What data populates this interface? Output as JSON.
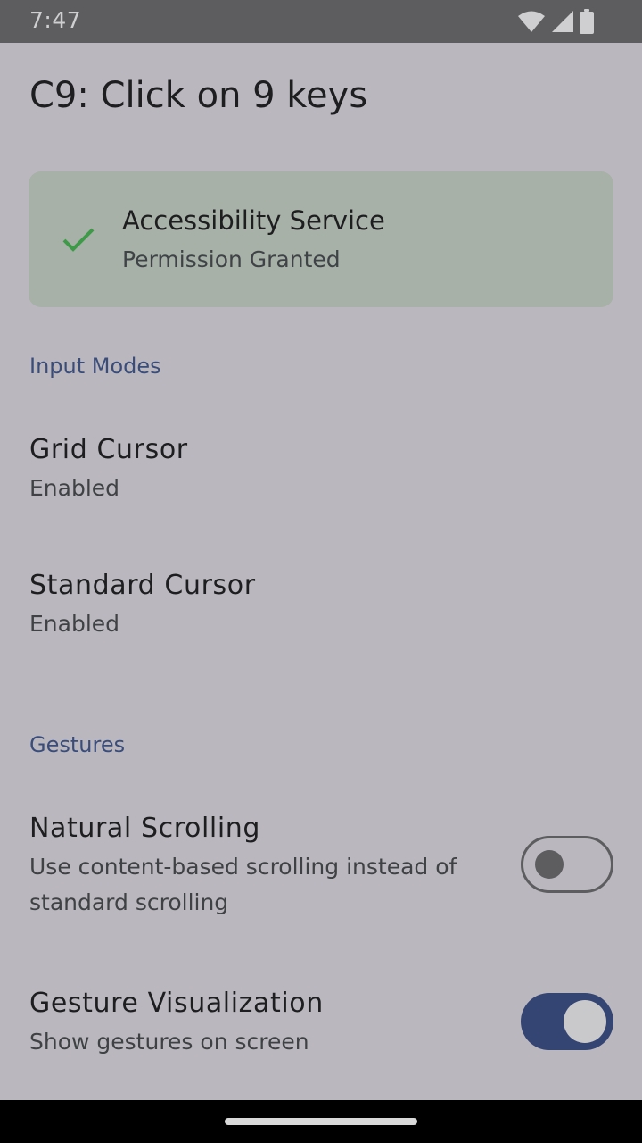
{
  "status_bar": {
    "time": "7:47",
    "icons": [
      "wifi-icon",
      "cell-signal-icon",
      "battery-icon"
    ]
  },
  "page": {
    "title": "C9: Click on 9 keys"
  },
  "permission_card": {
    "title": "Accessibility Service",
    "subtitle": "Permission Granted",
    "icon": "check-icon",
    "icon_color": "#3e9a48",
    "background": "#a7b1a7"
  },
  "sections": {
    "input_modes": {
      "header": "Input Modes",
      "items": [
        {
          "title": "Grid Cursor",
          "subtitle": "Enabled"
        },
        {
          "title": "Standard Cursor",
          "subtitle": "Enabled"
        }
      ]
    },
    "gestures": {
      "header": "Gestures",
      "items": [
        {
          "title": "Natural Scrolling",
          "subtitle": "Use content-based scrolling instead of standard scrolling",
          "toggle_on": false
        },
        {
          "title": "Gesture Visualization",
          "subtitle": "Show gestures on screen",
          "toggle_on": true
        }
      ]
    }
  },
  "colors": {
    "accent": "#344573",
    "section_header": "#3a4c7a",
    "background": "#bab8be"
  }
}
